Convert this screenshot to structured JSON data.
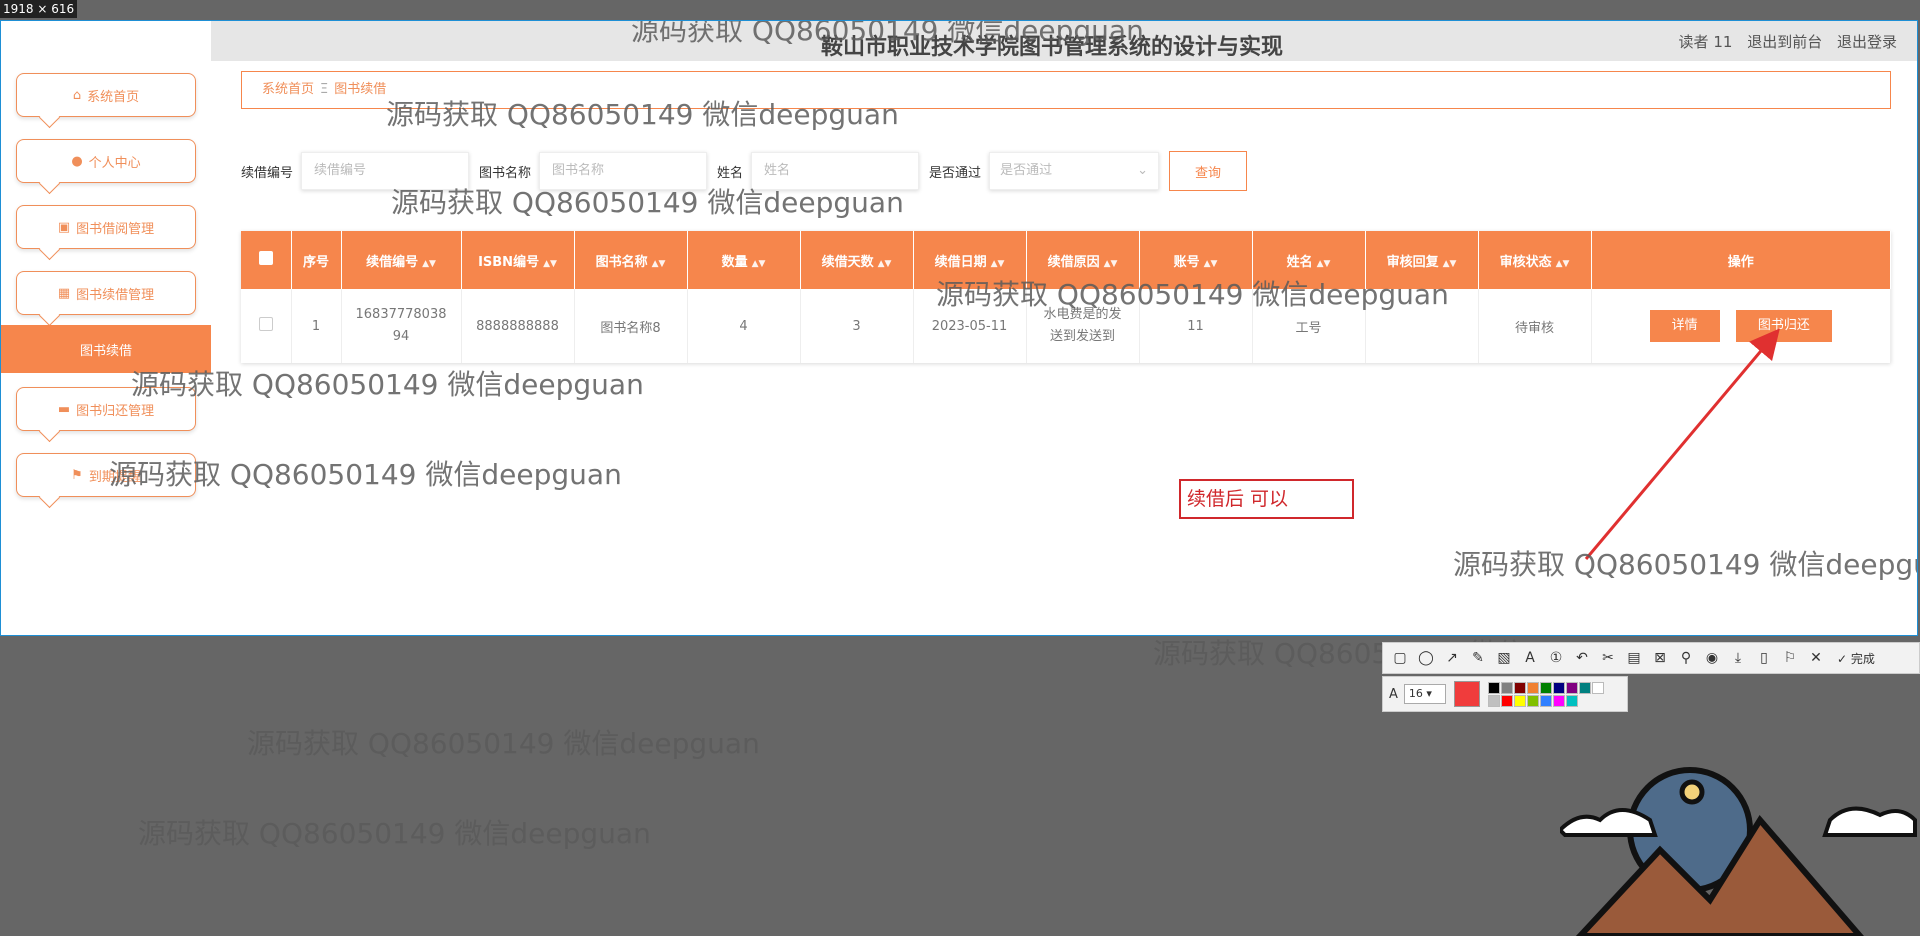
{
  "screen": {
    "size_tag": "1918 × 616"
  },
  "header": {
    "title": "鞍山市职业技术学院图书管理系统的设计与实现",
    "user": "读者 11",
    "back_front": "退出到前台",
    "logout": "退出登录"
  },
  "sidebar": {
    "items": [
      {
        "label": "系统首页",
        "icon": "home-icon"
      },
      {
        "label": "个人中心",
        "icon": "user-icon"
      },
      {
        "label": "图书借阅管理",
        "icon": "briefcase-icon"
      },
      {
        "label": "图书续借管理",
        "icon": "grid-icon"
      },
      {
        "label": "图书归还管理",
        "icon": "chat-icon"
      },
      {
        "label": "到期提醒",
        "icon": "flag-icon"
      }
    ],
    "active_sub": "图书续借"
  },
  "breadcrumb": {
    "home": "系统首页",
    "separator": "Ξ",
    "current": "图书续借"
  },
  "search": {
    "f1_label": "续借编号",
    "f1_placeholder": "续借编号",
    "f2_label": "图书名称",
    "f2_placeholder": "图书名称",
    "f3_label": "姓名",
    "f3_placeholder": "姓名",
    "f4_label": "是否通过",
    "f4_placeholder": "是否通过",
    "query_button": "查询"
  },
  "table": {
    "headers": [
      "序号",
      "续借编号",
      "ISBN编号",
      "图书名称",
      "数量",
      "续借天数",
      "续借日期",
      "续借原因",
      "账号",
      "姓名",
      "审核回复",
      "审核状态",
      "操作"
    ],
    "rows": [
      {
        "index": "1",
        "renew_no_line1": "16837778038",
        "renew_no_line2": "94",
        "isbn": "8888888888",
        "book_name": "图书名称8",
        "quantity": "4",
        "renew_days": "3",
        "renew_date": "2023-05-11",
        "reason_line1": "水电费是的发",
        "reason_line2": "送到发送到",
        "account": "11",
        "name": "工号",
        "reply": "",
        "status": "待审核",
        "detail_button": "详情",
        "return_button": "图书归还"
      }
    ]
  },
  "annotation": {
    "note": "续借后 可以",
    "color": "#d0282c"
  },
  "watermark": "源码获取 QQ86050149 微信deepguan",
  "capture_toolbar": {
    "done_label": "完成",
    "font_size": "16",
    "font_icon": "A",
    "current_color": "#f03c3c",
    "palette": [
      "#000000",
      "#808080",
      "#800000",
      "#f08030",
      "#008000",
      "#000080",
      "#800080",
      "#008080",
      "#ffffff",
      "#c0c0c0",
      "#ff0000",
      "#ffff00",
      "#80c000",
      "#3080ff",
      "#ff00ff",
      "#00c0c0"
    ]
  },
  "colors": {
    "accent": "#f6864c",
    "selection_border": "#1e8fd5"
  }
}
